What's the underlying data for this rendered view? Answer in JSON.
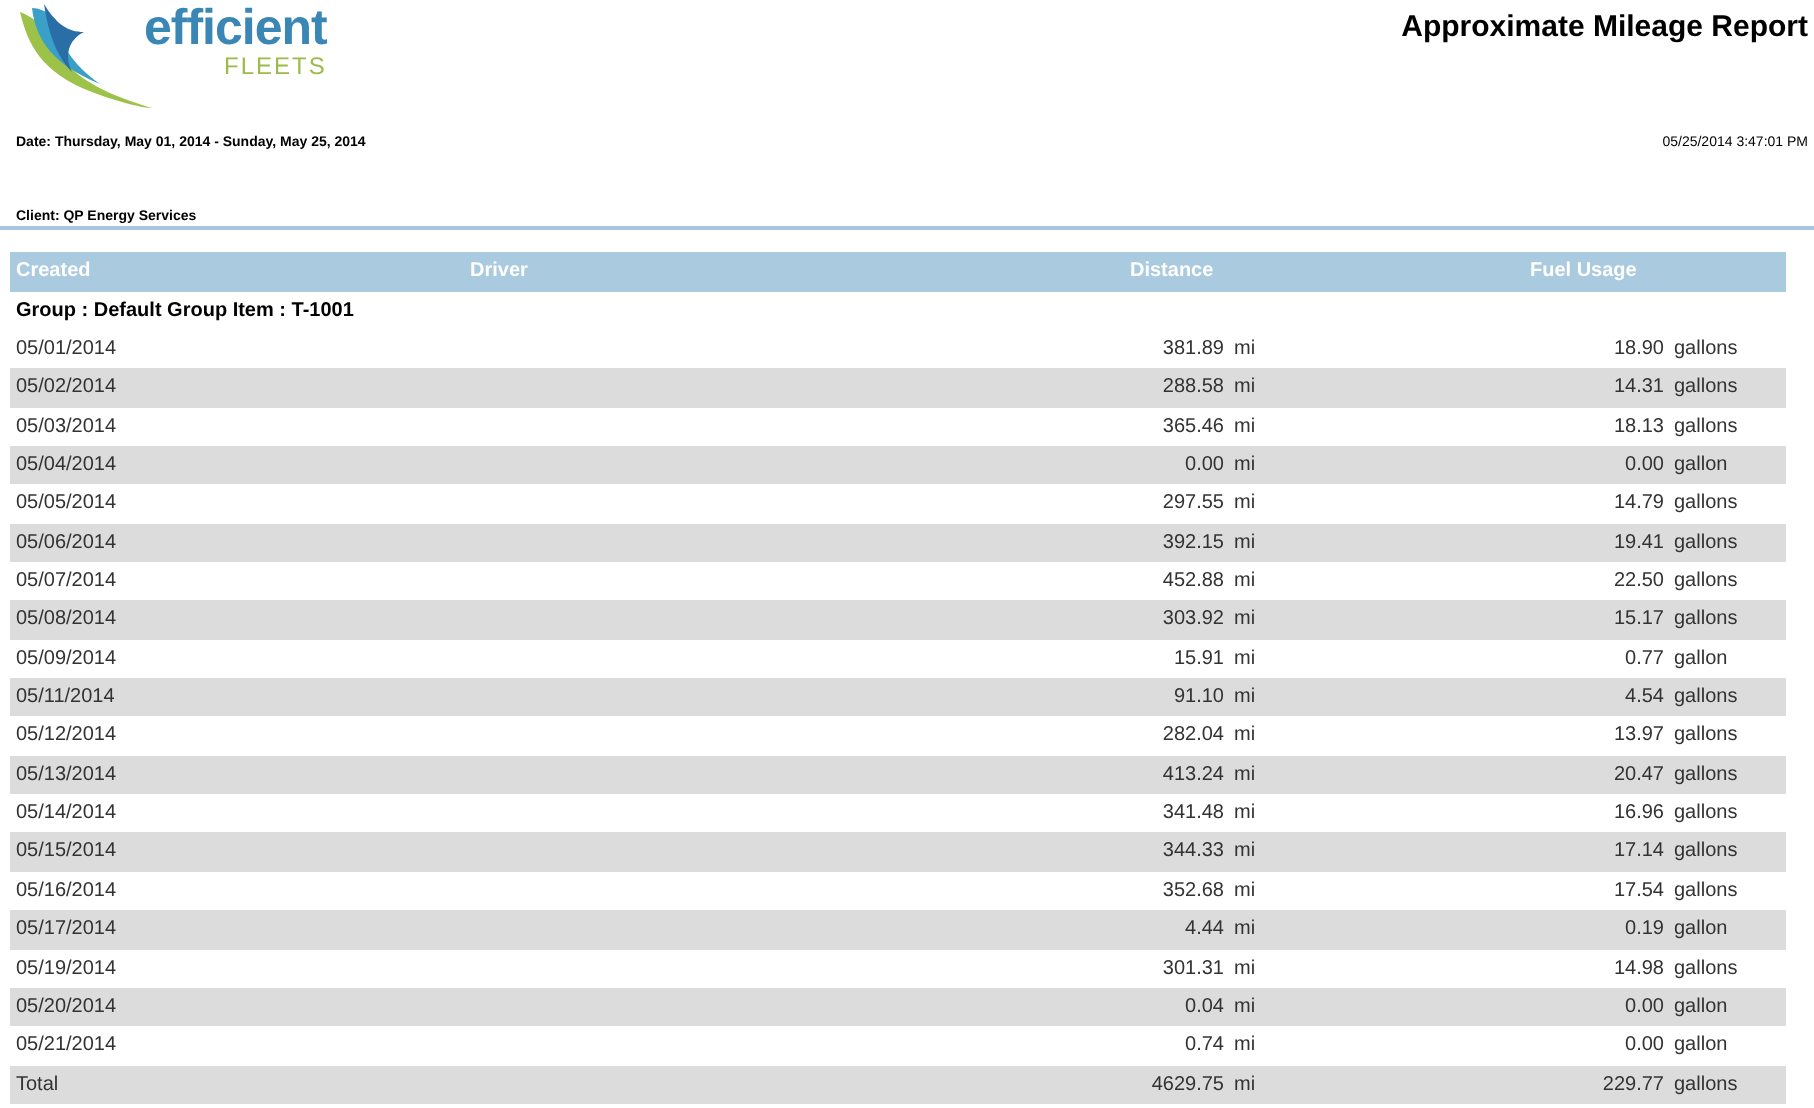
{
  "logo": {
    "word": "efficient",
    "subword": "FLEETS"
  },
  "title": "Approximate Mileage Report",
  "date_range": "Date: Thursday, May 01, 2014 - Sunday, May 25, 2014",
  "generated": "05/25/2014  3:47:01 PM",
  "client": "Client: QP Energy Services",
  "table": {
    "columns": [
      "Created",
      "Driver",
      "Distance",
      "Fuel Usage"
    ],
    "group": "Group : Default Group Item : T-1001",
    "rows": [
      {
        "created": "05/01/2014",
        "distance": "381.89",
        "distance_unit": "mi",
        "fuel": "18.90",
        "fuel_unit": "gallons"
      },
      {
        "created": "05/02/2014",
        "distance": "288.58",
        "distance_unit": "mi",
        "fuel": "14.31",
        "fuel_unit": "gallons"
      },
      {
        "created": "05/03/2014",
        "distance": "365.46",
        "distance_unit": "mi",
        "fuel": "18.13",
        "fuel_unit": "gallons"
      },
      {
        "created": "05/04/2014",
        "distance": "0.00",
        "distance_unit": "mi",
        "fuel": "0.00",
        "fuel_unit": "gallon"
      },
      {
        "created": "05/05/2014",
        "distance": "297.55",
        "distance_unit": "mi",
        "fuel": "14.79",
        "fuel_unit": "gallons"
      },
      {
        "created": "05/06/2014",
        "distance": "392.15",
        "distance_unit": "mi",
        "fuel": "19.41",
        "fuel_unit": "gallons"
      },
      {
        "created": "05/07/2014",
        "distance": "452.88",
        "distance_unit": "mi",
        "fuel": "22.50",
        "fuel_unit": "gallons"
      },
      {
        "created": "05/08/2014",
        "distance": "303.92",
        "distance_unit": "mi",
        "fuel": "15.17",
        "fuel_unit": "gallons"
      },
      {
        "created": "05/09/2014",
        "distance": "15.91",
        "distance_unit": "mi",
        "fuel": "0.77",
        "fuel_unit": "gallon"
      },
      {
        "created": "05/11/2014",
        "distance": "91.10",
        "distance_unit": "mi",
        "fuel": "4.54",
        "fuel_unit": "gallons"
      },
      {
        "created": "05/12/2014",
        "distance": "282.04",
        "distance_unit": "mi",
        "fuel": "13.97",
        "fuel_unit": "gallons"
      },
      {
        "created": "05/13/2014",
        "distance": "413.24",
        "distance_unit": "mi",
        "fuel": "20.47",
        "fuel_unit": "gallons"
      },
      {
        "created": "05/14/2014",
        "distance": "341.48",
        "distance_unit": "mi",
        "fuel": "16.96",
        "fuel_unit": "gallons"
      },
      {
        "created": "05/15/2014",
        "distance": "344.33",
        "distance_unit": "mi",
        "fuel": "17.14",
        "fuel_unit": "gallons"
      },
      {
        "created": "05/16/2014",
        "distance": "352.68",
        "distance_unit": "mi",
        "fuel": "17.54",
        "fuel_unit": "gallons"
      },
      {
        "created": "05/17/2014",
        "distance": "4.44",
        "distance_unit": "mi",
        "fuel": "0.19",
        "fuel_unit": "gallon"
      },
      {
        "created": "05/19/2014",
        "distance": "301.31",
        "distance_unit": "mi",
        "fuel": "14.98",
        "fuel_unit": "gallons"
      },
      {
        "created": "05/20/2014",
        "distance": "0.04",
        "distance_unit": "mi",
        "fuel": "0.00",
        "fuel_unit": "gallon"
      },
      {
        "created": "05/21/2014",
        "distance": "0.74",
        "distance_unit": "mi",
        "fuel": "0.00",
        "fuel_unit": "gallon"
      },
      {
        "created": "Total",
        "distance": "4629.75",
        "distance_unit": "mi",
        "fuel": "229.77",
        "fuel_unit": "gallons"
      }
    ]
  }
}
